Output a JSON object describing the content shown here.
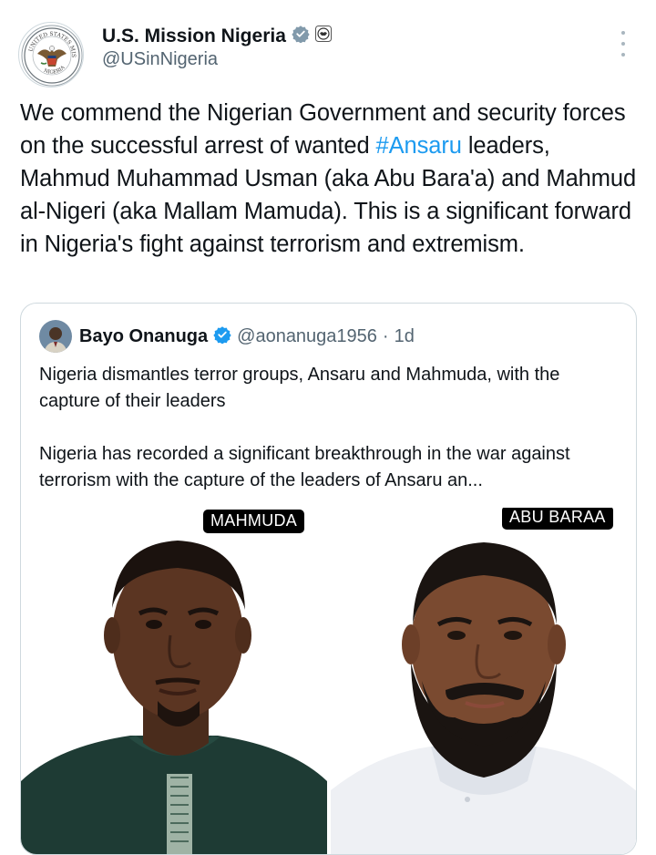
{
  "tweet": {
    "author": {
      "display_name": "U.S. Mission Nigeria",
      "handle": "@USinNigeria",
      "avatar_icon": "us-department-of-state-seal-icon",
      "verified_icon": "gray-verified-badge-icon",
      "affiliation_icon": "state-department-seal-mini-icon",
      "avatar_seal_text_top": "UNITED STATES MISSION",
      "avatar_seal_text_bottom": "NIGERIA"
    },
    "more_icon": "vertical-ellipsis-icon",
    "text_before": "We commend the Nigerian Government and security forces on the successful arrest of wanted ",
    "hashtag": "#Ansaru",
    "text_after": " leaders, Mahmud Muhammad Usman (aka Abu Bara'a) and Mahmud al-Nigeri (aka Mallam Mamuda). This is a significant forward in Nigeria's fight against terrorism and extremism."
  },
  "quote": {
    "display_name": "Bayo Onanuga",
    "verified_icon": "blue-verified-badge-icon",
    "handle": "@aonanuga1956",
    "separator": "·",
    "time": "1d",
    "paragraph1": "Nigeria dismantles terror groups, Ansaru and Mahmuda, with the capture of their leaders",
    "paragraph2": "Nigeria has recorded a significant breakthrough in the war against terrorism with the capture of the leaders of Ansaru an...",
    "photos": [
      {
        "caption": "MAHMUDA"
      },
      {
        "caption": "ABU BARAA"
      }
    ]
  },
  "colors": {
    "text": "#0f1419",
    "secondary": "#536471",
    "link": "#1d9bf0",
    "border": "#cfd9de"
  }
}
